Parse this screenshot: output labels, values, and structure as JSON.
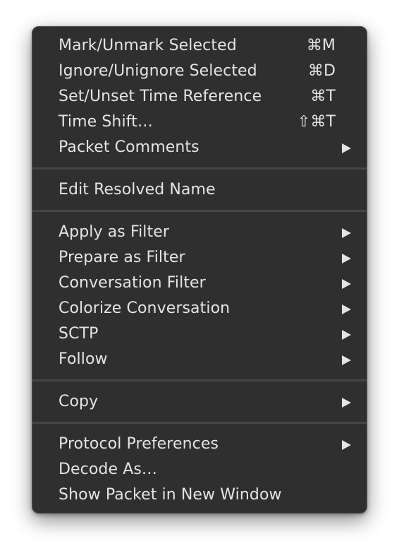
{
  "menu": {
    "group1": [
      {
        "label": "Mark/Unmark Selected",
        "shortcut": "⌘M"
      },
      {
        "label": "Ignore/Unignore Selected",
        "shortcut": "⌘D"
      },
      {
        "label": "Set/Unset Time Reference",
        "shortcut": "⌘T"
      },
      {
        "label": "Time Shift…",
        "shortcut": "⇧⌘T"
      },
      {
        "label": "Packet Comments",
        "submenu": true
      }
    ],
    "group2": [
      {
        "label": "Edit Resolved Name"
      }
    ],
    "group3": [
      {
        "label": "Apply as Filter",
        "submenu": true
      },
      {
        "label": "Prepare as Filter",
        "submenu": true
      },
      {
        "label": "Conversation Filter",
        "submenu": true
      },
      {
        "label": "Colorize Conversation",
        "submenu": true
      },
      {
        "label": "SCTP",
        "submenu": true
      },
      {
        "label": "Follow",
        "submenu": true
      }
    ],
    "group4": [
      {
        "label": "Copy",
        "submenu": true
      }
    ],
    "group5": [
      {
        "label": "Protocol Preferences",
        "submenu": true
      },
      {
        "label": "Decode As…"
      },
      {
        "label": "Show Packet in New Window"
      }
    ]
  }
}
